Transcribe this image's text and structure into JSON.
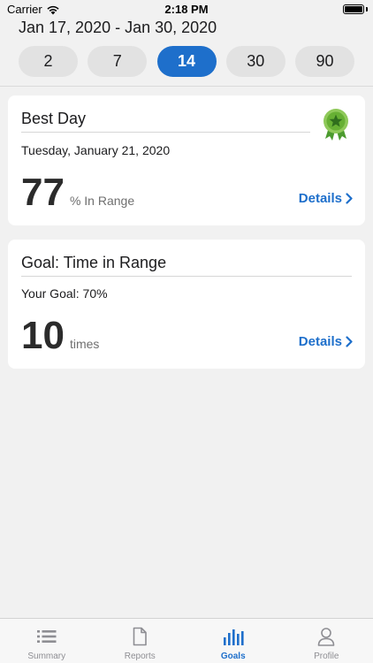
{
  "status_bar": {
    "carrier": "Carrier",
    "time": "2:18 PM"
  },
  "header": {
    "date_range": "Jan 17, 2020 - Jan 30, 2020"
  },
  "range_picker": {
    "options": [
      "2",
      "7",
      "14",
      "30",
      "90"
    ],
    "selected": "14",
    "active_color": "#1e6fcb"
  },
  "best_day_card": {
    "title": "Best Day",
    "date": "Tuesday, January 21, 2020",
    "value": "77",
    "unit": "% In Range",
    "details_label": "Details",
    "icon": "award-ribbon-icon"
  },
  "goal_card": {
    "title": "Goal: Time in Range",
    "goal_text": "Your Goal: 70%",
    "value": "10",
    "unit": "times",
    "details_label": "Details"
  },
  "tab_bar": {
    "items": [
      {
        "label": "Summary",
        "icon": "list-icon"
      },
      {
        "label": "Reports",
        "icon": "document-icon"
      },
      {
        "label": "Goals",
        "icon": "bar-chart-icon"
      },
      {
        "label": "Profile",
        "icon": "person-icon"
      }
    ],
    "active": "Goals"
  }
}
